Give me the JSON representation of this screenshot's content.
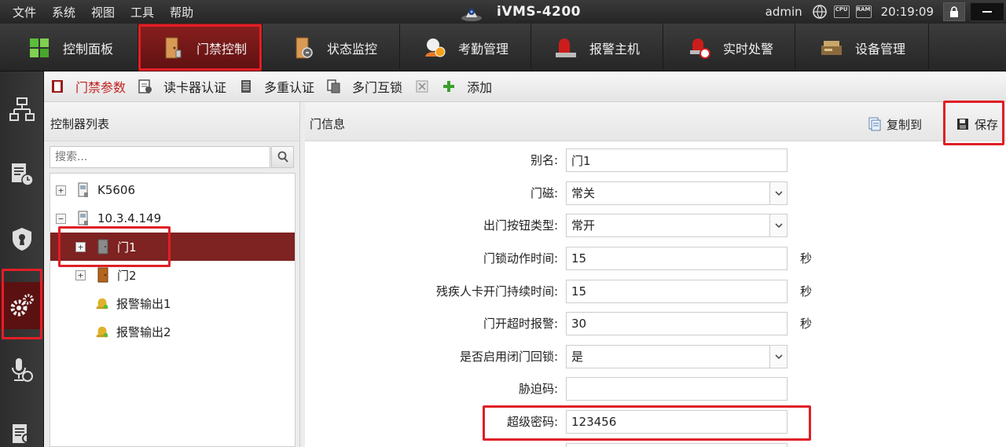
{
  "menubar": {
    "items": [
      "文件",
      "系统",
      "视图",
      "工具",
      "帮助"
    ],
    "app_title": "iVMS-4200",
    "user": "admin",
    "cpu_label": "CPU",
    "ram_label": "RAM",
    "time": "20:19:09"
  },
  "modules": [
    {
      "label": "控制面板",
      "icon": "control-panel-icon"
    },
    {
      "label": "门禁控制",
      "icon": "access-door-icon",
      "active": true
    },
    {
      "label": "状态监控",
      "icon": "status-monitor-icon"
    },
    {
      "label": "考勤管理",
      "icon": "attendance-icon"
    },
    {
      "label": "报警主机",
      "icon": "alarm-host-icon"
    },
    {
      "label": "实时处警",
      "icon": "alarm-handling-icon"
    },
    {
      "label": "设备管理",
      "icon": "device-management-icon"
    }
  ],
  "leftbar": [
    {
      "icon": "network-icon"
    },
    {
      "icon": "log-icon"
    },
    {
      "icon": "shield-icon"
    },
    {
      "icon": "settings-icon",
      "active": true
    },
    {
      "icon": "mic-icon"
    },
    {
      "icon": "report-search-icon"
    }
  ],
  "subtabs": [
    {
      "label": "门禁参数",
      "active": true
    },
    {
      "label": "读卡器认证"
    },
    {
      "label": "多重认证"
    },
    {
      "label": "多门互锁"
    },
    {
      "label": "添加"
    }
  ],
  "controller_panel": {
    "title": "控制器列表",
    "search_placeholder": "搜索...",
    "tree": [
      {
        "label": "K5606",
        "toggle": "+"
      },
      {
        "label": "10.3.4.149",
        "toggle": "−"
      },
      {
        "label": "门1",
        "toggle": "+",
        "selected": true
      },
      {
        "label": "门2",
        "toggle": "+"
      },
      {
        "label": "报警输出1"
      },
      {
        "label": "报警输出2"
      }
    ]
  },
  "door_panel": {
    "title": "门信息",
    "copy_label": "复制到",
    "save_label": "保存",
    "fields": [
      {
        "label": "别名:",
        "value": "门1",
        "type": "text"
      },
      {
        "label": "门磁:",
        "value": "常关",
        "type": "select"
      },
      {
        "label": "出门按钮类型:",
        "value": "常开",
        "type": "select"
      },
      {
        "label": "门锁动作时间:",
        "value": "15",
        "type": "text",
        "unit": "秒"
      },
      {
        "label": "残疾人卡开门持续时间:",
        "value": "15",
        "type": "text",
        "unit": "秒"
      },
      {
        "label": "门开超时报警:",
        "value": "30",
        "type": "text",
        "unit": "秒"
      },
      {
        "label": "是否启用闭门回锁:",
        "value": "是",
        "type": "select"
      },
      {
        "label": "胁迫码:",
        "value": "",
        "type": "text"
      },
      {
        "label": "超级密码:",
        "value": "123456",
        "type": "text"
      }
    ]
  },
  "colors": {
    "highlight": "#e01f26",
    "active_module": "#7a1717",
    "selected_node": "#7e2222",
    "active_subtab_text": "#c32222"
  }
}
